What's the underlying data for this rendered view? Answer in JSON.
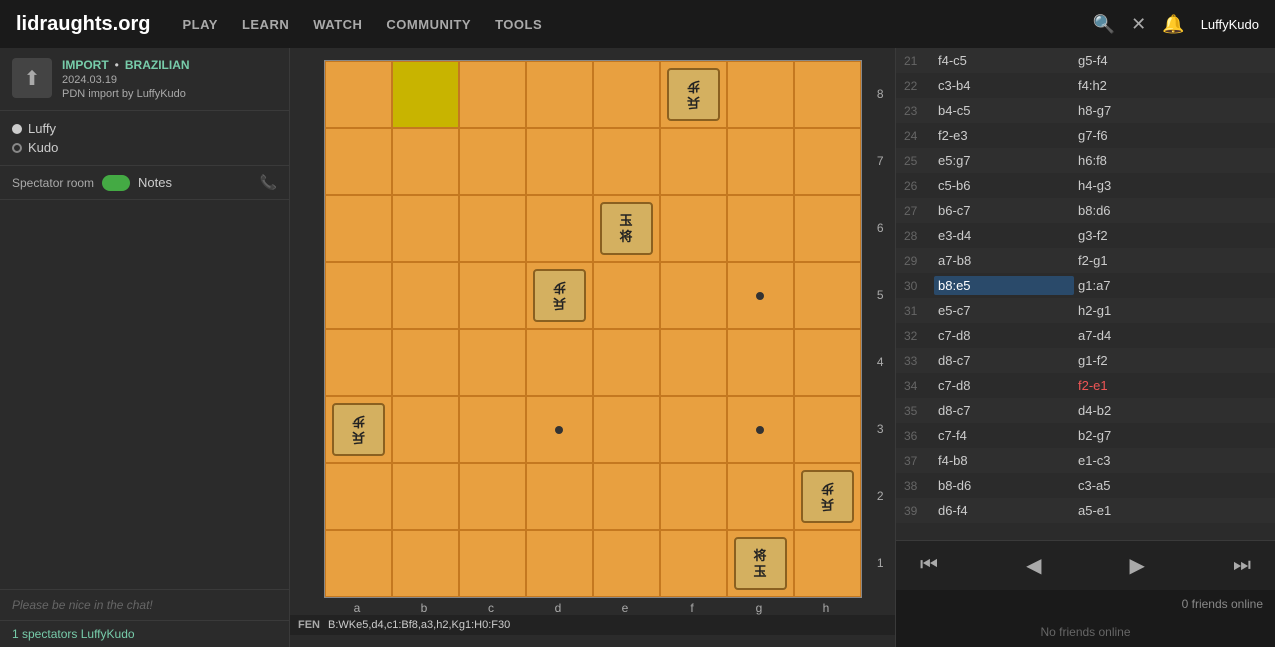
{
  "nav": {
    "logo": "lidraughts.org",
    "items": [
      "PLAY",
      "LEARN",
      "WATCH",
      "COMMUNITY",
      "TOOLS"
    ],
    "username": "LuffyKudo"
  },
  "sidebar": {
    "import_label": "IMPORT",
    "separator": "•",
    "variant_label": "BRAZILIAN",
    "date": "2024.03.19",
    "pdn_import": "PDN import by LuffyKudo",
    "player_white": "Luffy",
    "player_black": "Kudo",
    "spectator_room_label": "Spectator room",
    "notes_label": "Notes",
    "chat_placeholder": "Please be nice in the chat!",
    "spectator_count": "1 spectators",
    "spectator_user": "LuffyKudo"
  },
  "fen": {
    "label": "FEN",
    "value": "B:WKe5,d4,c1:Bf8,a3,h2,Kg1:H0:F30"
  },
  "moves": [
    {
      "num": 21,
      "white": "f4-c5",
      "black": "g5-f4"
    },
    {
      "num": 22,
      "white": "c3-b4",
      "black": "f4:h2"
    },
    {
      "num": 23,
      "white": "b4-c5",
      "black": "h8-g7"
    },
    {
      "num": 24,
      "white": "f2-e3",
      "black": "g7-f6"
    },
    {
      "num": 25,
      "white": "e5:g7",
      "black": "h6:f8"
    },
    {
      "num": 26,
      "white": "c5-b6",
      "black": "h4-g3"
    },
    {
      "num": 27,
      "white": "b6-c7",
      "black": "b8:d6"
    },
    {
      "num": 28,
      "white": "e3-d4",
      "black": "g3-f2"
    },
    {
      "num": 29,
      "white": "a7-b8",
      "black": "f2-g1"
    },
    {
      "num": 30,
      "white": "b8:e5",
      "black": "g1:a7",
      "active": true
    },
    {
      "num": 31,
      "white": "e5-c7",
      "black": "h2-g1"
    },
    {
      "num": 32,
      "white": "c7-d8",
      "black": "a7-d4"
    },
    {
      "num": 33,
      "white": "d8-c7",
      "black": "g1-f2"
    },
    {
      "num": 34,
      "white": "c7-d8",
      "black": "f2-e1",
      "black_red": true
    },
    {
      "num": 35,
      "white": "d8-c7",
      "black": "d4-b2"
    },
    {
      "num": 36,
      "white": "c7-f4",
      "black": "b2-g7"
    },
    {
      "num": 37,
      "white": "f4-b8",
      "black": "e1-c3"
    },
    {
      "num": 38,
      "white": "b8-d6",
      "black": "c3-a5"
    },
    {
      "num": 39,
      "white": "d6-f4",
      "black": "a5-e1"
    }
  ],
  "controls": {
    "first": "⏮",
    "prev": "◀",
    "next": "▶",
    "last": "⏭"
  },
  "friends": {
    "count_label": "0 friends online",
    "no_friends_label": "No friends online"
  },
  "board": {
    "col_labels": [
      "a",
      "b",
      "c",
      "d",
      "e",
      "f",
      "g",
      "h"
    ],
    "row_labels": [
      "8",
      "7",
      "6",
      "5",
      "4",
      "3",
      "2",
      "1"
    ]
  }
}
